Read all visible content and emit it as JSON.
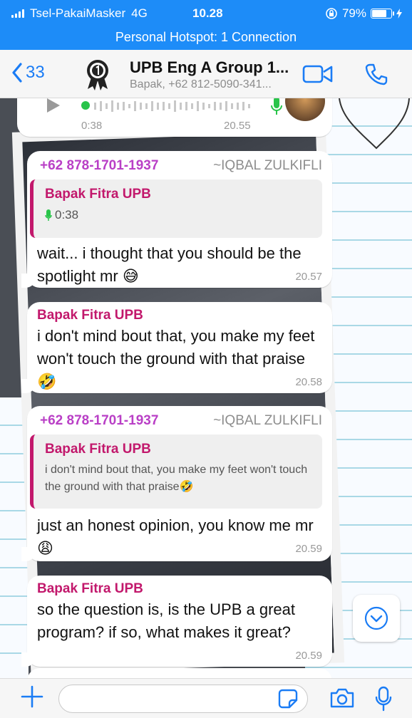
{
  "status": {
    "carrier": "Tsel-PakaiMasker",
    "network": "4G",
    "time": "10.28",
    "battery": "79%",
    "battery_level": 0.79,
    "hotspot": "Personal Hotspot: 1 Connection"
  },
  "header": {
    "back_count": "33",
    "title": "UPB Eng A Group 1...",
    "subtitle": "Bapak, +62 812-5090-341..."
  },
  "messages": [
    {
      "type": "voice",
      "duration": "0:38",
      "time": "20.55"
    },
    {
      "phone": "+62 878-1701-1937",
      "alias": "~IQBAL ZULKIFLI",
      "quote_sender": "Bapak Fitra UPB",
      "quote_voice": "0:38",
      "text": "wait... i thought that you should be the spotlight mr 😅",
      "time": "20.57"
    },
    {
      "sender": "Bapak Fitra UPB",
      "text": "i don't mind bout that, you make my feet won't touch the ground with that praise🤣",
      "time": "20.58"
    },
    {
      "phone": "+62 878-1701-1937",
      "alias": "~IQBAL ZULKIFLI",
      "quote_sender": "Bapak Fitra UPB",
      "quote_text": "i don't mind bout that, you make my feet won't touch the ground with that praise🤣",
      "text": "just an honest opinion, you know me mr 😩",
      "time": "20.59"
    },
    {
      "sender": "Bapak Fitra UPB",
      "text": "so the question is, is the UPB a great program? if so, what makes it great?",
      "time": "20.59"
    }
  ],
  "input": {
    "placeholder": ""
  },
  "colors": {
    "status_bar": "#1d8cf8",
    "ios_blue": "#1a7cf5",
    "sender_name": "#c2186c",
    "phone_name": "#b93fc6",
    "voice_green": "#29c44a"
  }
}
